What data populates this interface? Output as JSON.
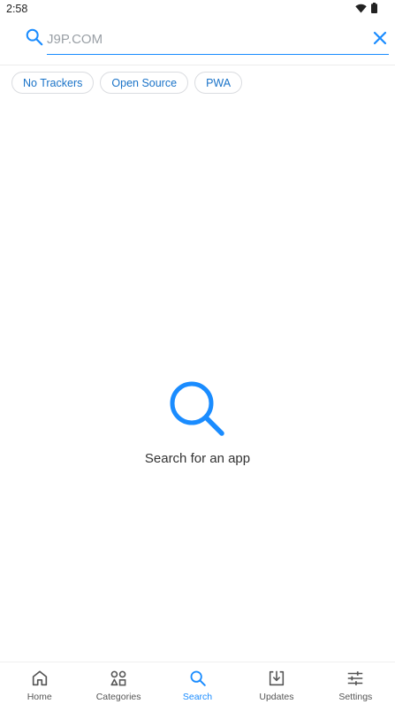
{
  "status_bar": {
    "time": "2:58",
    "icons": [
      "wifi-icon",
      "battery-icon"
    ]
  },
  "search": {
    "value": "J9P.COM",
    "icon": "search-icon",
    "clear_icon": "close-icon"
  },
  "chips": [
    {
      "label": "No Trackers"
    },
    {
      "label": "Open Source"
    },
    {
      "label": "PWA"
    }
  ],
  "empty_state": {
    "icon": "search-icon",
    "text": "Search for an app"
  },
  "bottom_nav": {
    "items": [
      {
        "label": "Home",
        "icon": "home-icon",
        "active": false
      },
      {
        "label": "Categories",
        "icon": "categories-icon",
        "active": false
      },
      {
        "label": "Search",
        "icon": "search-icon",
        "active": true
      },
      {
        "label": "Updates",
        "icon": "download-icon",
        "active": false
      },
      {
        "label": "Settings",
        "icon": "sliders-icon",
        "active": false
      }
    ]
  },
  "colors": {
    "accent": "#1a8cff",
    "chip_text": "#1a73c8",
    "text": "#333333"
  }
}
